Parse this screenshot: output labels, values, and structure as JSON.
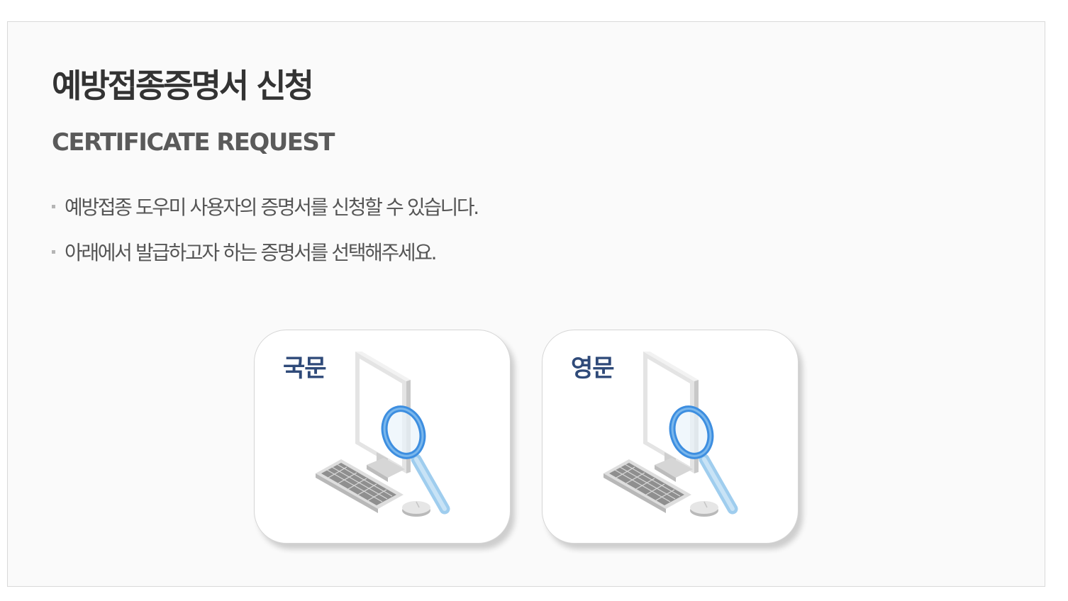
{
  "page": {
    "title": "예방접종증명서 신청",
    "subtitle": "CERTIFICATE REQUEST",
    "descriptions": [
      "예방접종 도우미 사용자의 증명서를 신청할 수 있습니다.",
      "아래에서 발급하고자 하는 증명서를 선택해주세요."
    ]
  },
  "options": [
    {
      "label": "국문",
      "icon": "computer-search-icon"
    },
    {
      "label": "영문",
      "icon": "computer-search-icon"
    }
  ],
  "colors": {
    "title": "#333333",
    "option_label": "#2f4a79",
    "magnifier": "#3d8ee0",
    "panel_background": "#fafafa"
  }
}
